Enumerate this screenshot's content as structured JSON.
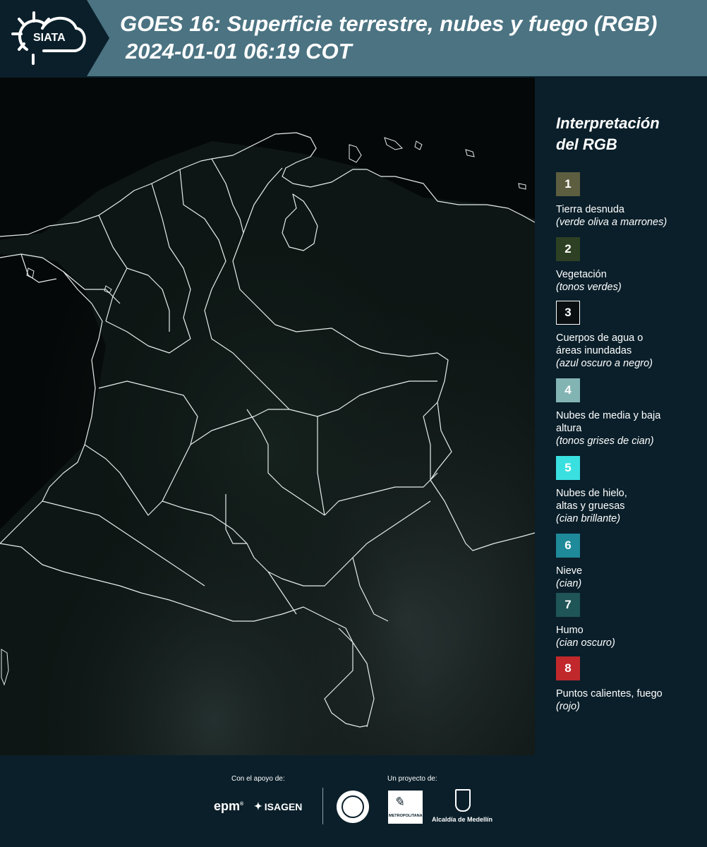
{
  "header": {
    "logo_text": "SIATA",
    "title_line1": "GOES 16: Superficie terrestre, nubes y fuego (RGB)",
    "title_line2": "2024-01-01 06:19 COT"
  },
  "legend": {
    "title_line1": "Interpretación",
    "title_line2": "del RGB",
    "items": [
      {
        "number": "1",
        "color": "#5c5e3f",
        "label": "Tierra desnuda",
        "hint": "(verde oliva a marrones)"
      },
      {
        "number": "2",
        "color": "#2d4023",
        "label": "Vegetación",
        "hint": "(tonos verdes)"
      },
      {
        "number": "3",
        "color": "#0a0f12",
        "label": "Cuerpos de agua o áreas inundadas",
        "hint": "(azul oscuro a negro)"
      },
      {
        "number": "4",
        "color": "#83b4b4",
        "label": "Nubes de media y baja altura",
        "hint": "(tonos grises de cian)"
      },
      {
        "number": "5",
        "color": "#3ae0e0",
        "label": "Nubes de hielo, altas y gruesas",
        "hint": "(cian brillante)"
      },
      {
        "number": "6",
        "color": "#1e8a9a",
        "label": "Nieve",
        "hint": "(cian)"
      },
      {
        "number": "7",
        "color": "#1f5556",
        "label": "Humo",
        "hint": "(cian oscuro)"
      },
      {
        "number": "8",
        "color": "#c0282c",
        "label": "Puntos calientes, fuego",
        "hint": "(rojo)"
      }
    ]
  },
  "footer": {
    "support_label": "Con el apoyo de:",
    "project_label": "Un proyecto de:",
    "sponsor_1": "epm",
    "sponsor_2": "ISAGEN",
    "partner_1": "METROPOLITANA",
    "partner_2": "Alcaldía de Medellín"
  }
}
